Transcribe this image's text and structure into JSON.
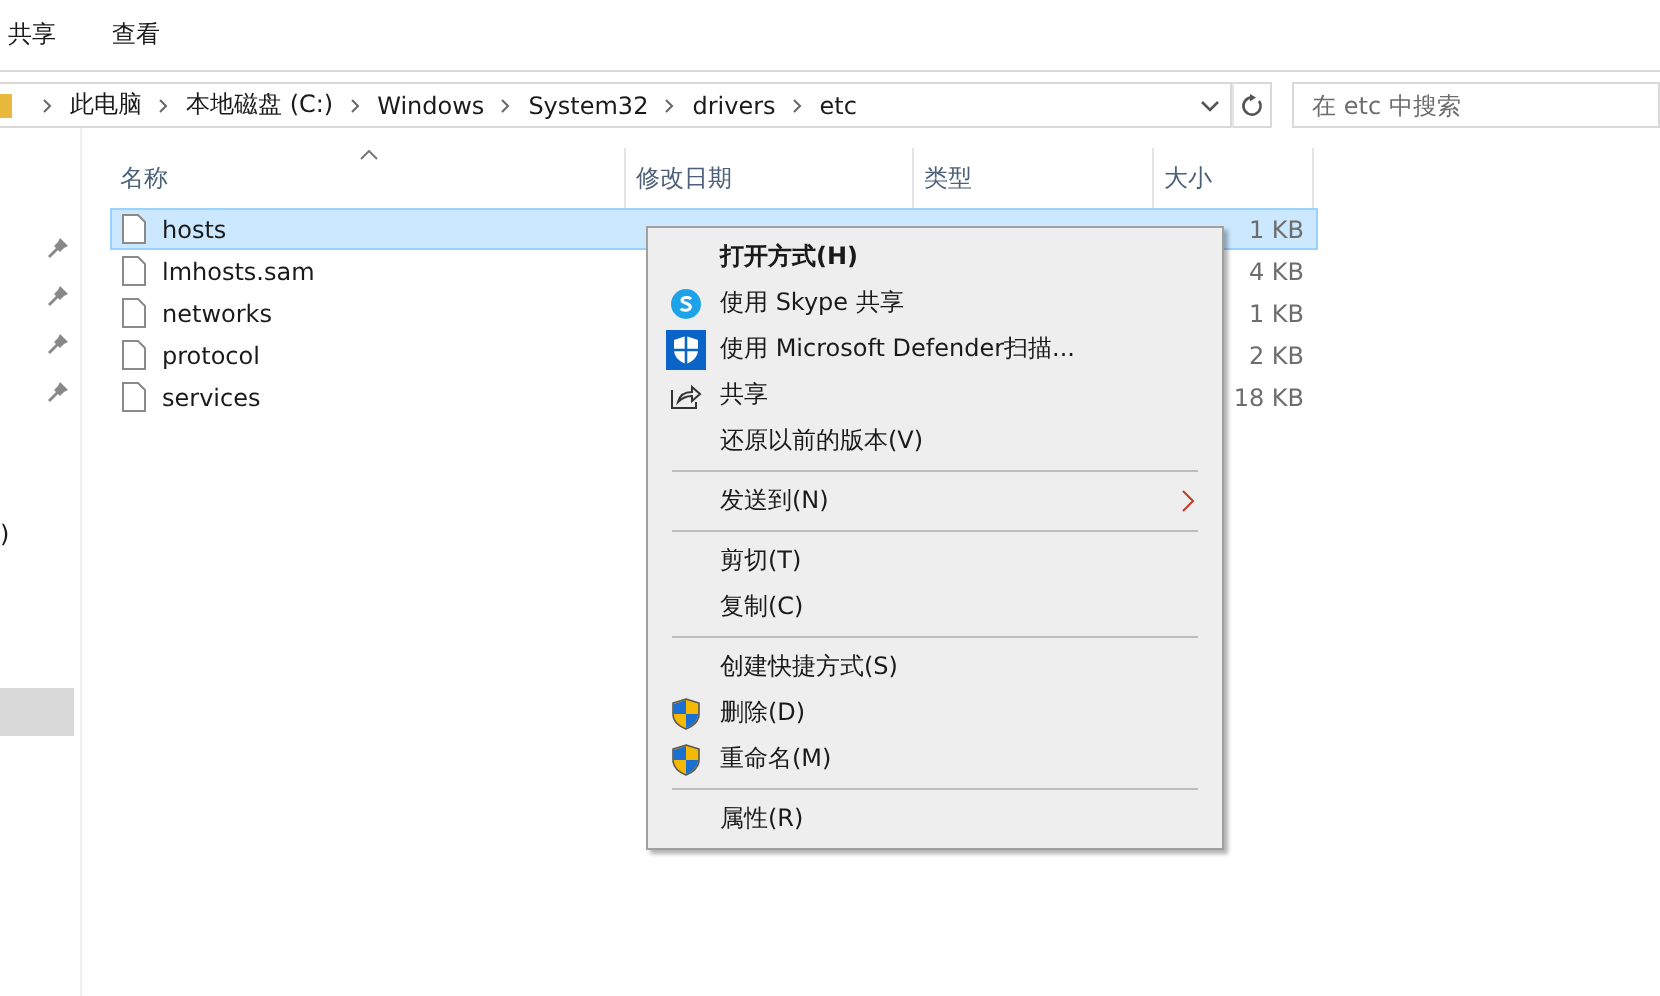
{
  "ribbon_tabs": [
    {
      "label": "共享"
    },
    {
      "label": "查看"
    }
  ],
  "address_bar": {
    "path": [
      "此电脑",
      "本地磁盘 (C:)",
      "Windows",
      "System32",
      "drivers",
      "etc"
    ]
  },
  "search": {
    "placeholder": "在 etc 中搜索"
  },
  "nav_pane": {
    "partial_text": ")"
  },
  "table": {
    "columns": [
      {
        "label": "名称",
        "sorted": true
      },
      {
        "label": "修改日期",
        "sorted": false
      },
      {
        "label": "类型",
        "sorted": false
      },
      {
        "label": "大小",
        "sorted": false
      }
    ],
    "rows": [
      {
        "name": "hosts",
        "size": "1 KB",
        "selected": true
      },
      {
        "name": "lmhosts.sam",
        "size": "4 KB",
        "selected": false
      },
      {
        "name": "networks",
        "size": "1 KB",
        "selected": false
      },
      {
        "name": "protocol",
        "size": "2 KB",
        "selected": false
      },
      {
        "name": "services",
        "size": "18 KB",
        "selected": false
      }
    ]
  },
  "context_menu": [
    {
      "kind": "item",
      "label": "打开方式(H)",
      "bold": true
    },
    {
      "kind": "skype",
      "label": "使用 Skype 共享",
      "bold": false
    },
    {
      "kind": "defender",
      "label": "使用 Microsoft Defender扫描...",
      "bold": false
    },
    {
      "kind": "share",
      "label": "共享",
      "bold": false
    },
    {
      "kind": "item",
      "label": "还原以前的版本(V)",
      "bold": false
    },
    {
      "kind": "separator"
    },
    {
      "kind": "submenu",
      "label": "发送到(N)",
      "bold": false
    },
    {
      "kind": "separator"
    },
    {
      "kind": "item",
      "label": "剪切(T)",
      "bold": false
    },
    {
      "kind": "item",
      "label": "复制(C)",
      "bold": false
    },
    {
      "kind": "separator"
    },
    {
      "kind": "item",
      "label": "创建快捷方式(S)",
      "bold": false
    },
    {
      "kind": "uac",
      "label": "删除(D)",
      "bold": false
    },
    {
      "kind": "uac",
      "label": "重命名(M)",
      "bold": false
    },
    {
      "kind": "separator"
    },
    {
      "kind": "item",
      "label": "属性(R)",
      "bold": false
    }
  ]
}
